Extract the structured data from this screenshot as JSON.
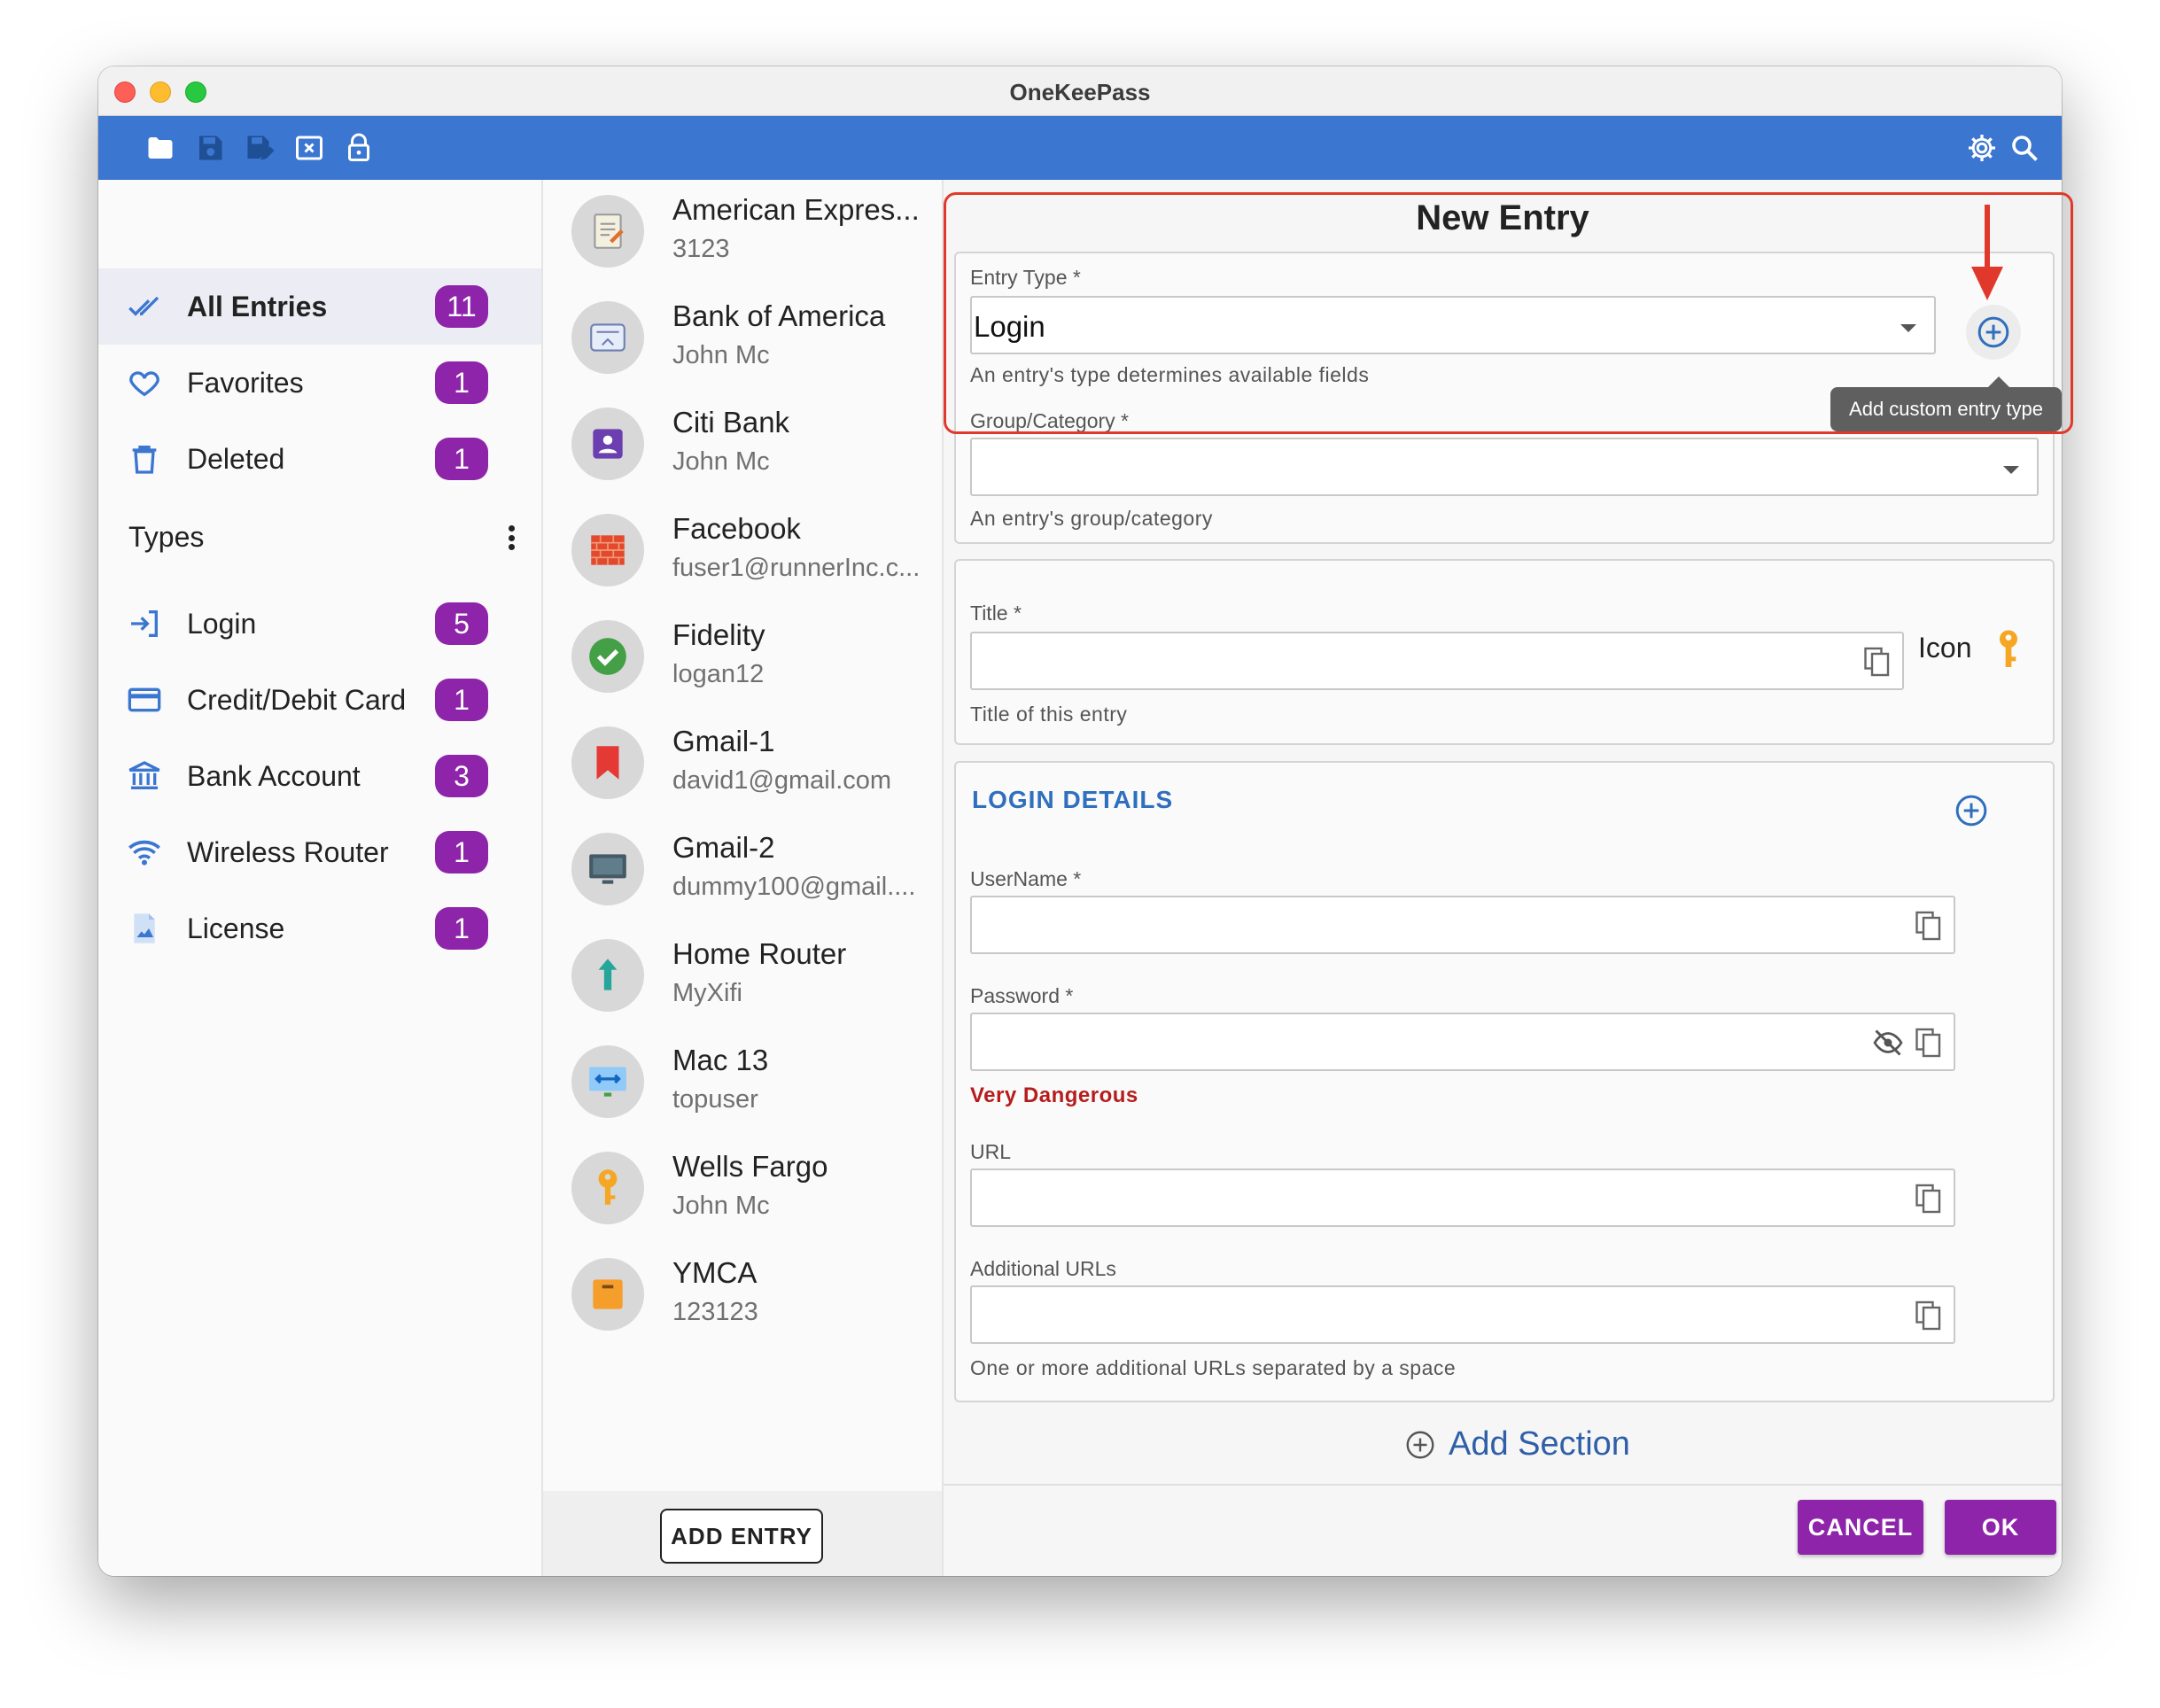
{
  "window": {
    "title": "OneKeePass"
  },
  "toolbar": {
    "left_icons": [
      "folder-open-icon",
      "save-icon",
      "save-as-icon",
      "close-database-icon",
      "lock-icon"
    ],
    "right_icons": [
      "settings-icon",
      "search-icon"
    ]
  },
  "sidebar": {
    "categories": [
      {
        "label": "All Entries",
        "count": "11",
        "icon": "double-check-icon"
      },
      {
        "label": "Favorites",
        "count": "1",
        "icon": "heart-icon"
      },
      {
        "label": "Deleted",
        "count": "1",
        "icon": "trash-icon"
      }
    ],
    "types_header": "Types",
    "types": [
      {
        "label": "Login",
        "count": "5",
        "icon": "login-icon"
      },
      {
        "label": "Credit/Debit Card",
        "count": "1",
        "icon": "credit-card-icon"
      },
      {
        "label": "Bank Account",
        "count": "3",
        "icon": "bank-icon"
      },
      {
        "label": "Wireless Router",
        "count": "1",
        "icon": "wifi-icon"
      },
      {
        "label": "License",
        "count": "1",
        "icon": "license-icon"
      }
    ]
  },
  "entries": [
    {
      "title": "American Expres...",
      "subtitle": "3123",
      "icon": "notepad-icon"
    },
    {
      "title": "Bank of America",
      "subtitle": "John Mc",
      "icon": "bank-card-icon"
    },
    {
      "title": "Citi Bank",
      "subtitle": "John Mc",
      "icon": "person-card-icon"
    },
    {
      "title": "Facebook",
      "subtitle": "fuser1@runnerInc.c...",
      "icon": "brick-wall-icon"
    },
    {
      "title": "Fidelity",
      "subtitle": "logan12",
      "icon": "check-circle-icon"
    },
    {
      "title": "Gmail-1",
      "subtitle": "david1@gmail.com",
      "icon": "bookmark-icon"
    },
    {
      "title": "Gmail-2",
      "subtitle": "dummy100@gmail....",
      "icon": "monitor-icon"
    },
    {
      "title": "Home Router",
      "subtitle": "MyXifi",
      "icon": "upload-arrow-icon"
    },
    {
      "title": "Mac 13",
      "subtitle": "topuser",
      "icon": "display-arrows-icon"
    },
    {
      "title": "Wells Fargo",
      "subtitle": "John Mc",
      "icon": "key-icon"
    },
    {
      "title": "YMCA",
      "subtitle": "123123",
      "icon": "folder-icon"
    }
  ],
  "entry_list_footer": {
    "add_entry_label": "ADD ENTRY"
  },
  "form": {
    "title": "New Entry",
    "entry_type": {
      "label": "Entry Type *",
      "value": "Login",
      "helper": "An entry's type determines available fields",
      "add_tooltip": "Add custom entry type"
    },
    "group": {
      "label": "Group/Category *",
      "value": "",
      "helper": "An entry's group/category"
    },
    "title_field": {
      "label": "Title *",
      "value": "",
      "helper": "Title of this entry",
      "icon_label": "Icon"
    },
    "login_details": {
      "section_title": "LOGIN DETAILS",
      "username_label": "UserName *",
      "password_label": "Password *",
      "password_strength": "Very Dangerous",
      "url_label": "URL",
      "additional_urls_label": "Additional URLs",
      "additional_urls_helper": "One or more additional URLs separated by a space"
    },
    "add_section_label": "Add Section",
    "cancel_label": "CANCEL",
    "ok_label": "OK"
  },
  "colors": {
    "toolbar": "#3b76d0",
    "badge": "#8e24aa",
    "accent_blue": "#2f6fbd",
    "danger": "#b71c1c",
    "highlight": "#e0392b"
  }
}
